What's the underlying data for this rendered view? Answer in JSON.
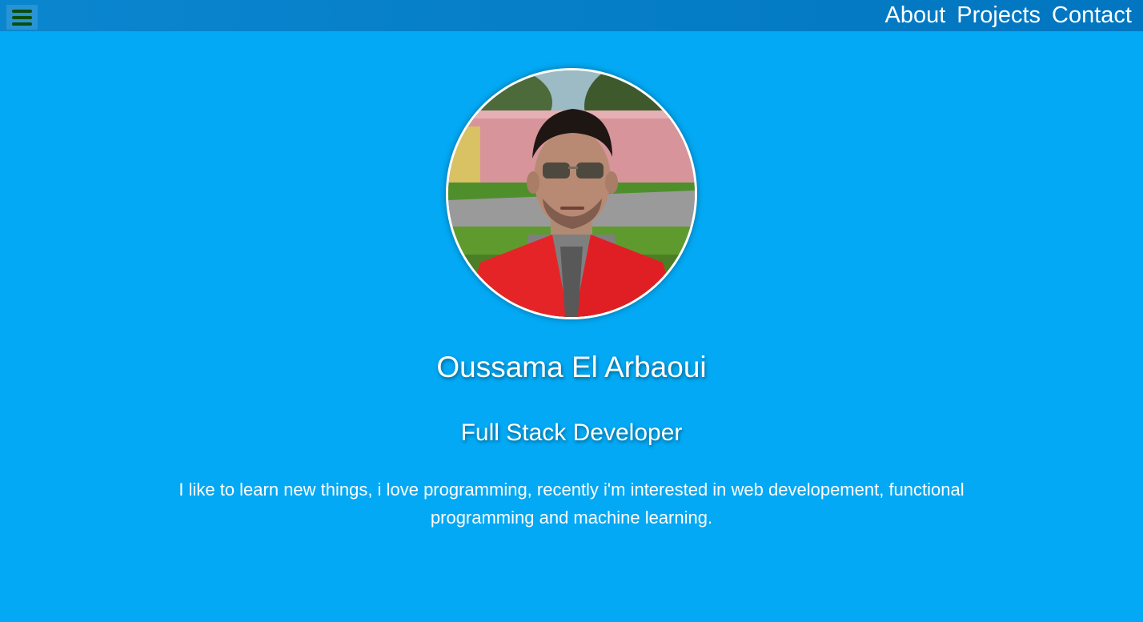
{
  "header": {
    "menu_icon": "hamburger-menu-icon",
    "nav": [
      {
        "label": "About"
      },
      {
        "label": "Projects"
      },
      {
        "label": "Contact"
      }
    ]
  },
  "profile": {
    "name": "Oussama El Arbaoui",
    "role": "Full Stack Developer",
    "bio": "I like to learn new things, i love programming, recently i'm interested in web developement, functional programming and machine learning."
  },
  "colors": {
    "background": "#03a9f4",
    "topbar": "#0277bd",
    "menu_icon": "#0b4d0e",
    "text": "#ffffff"
  }
}
